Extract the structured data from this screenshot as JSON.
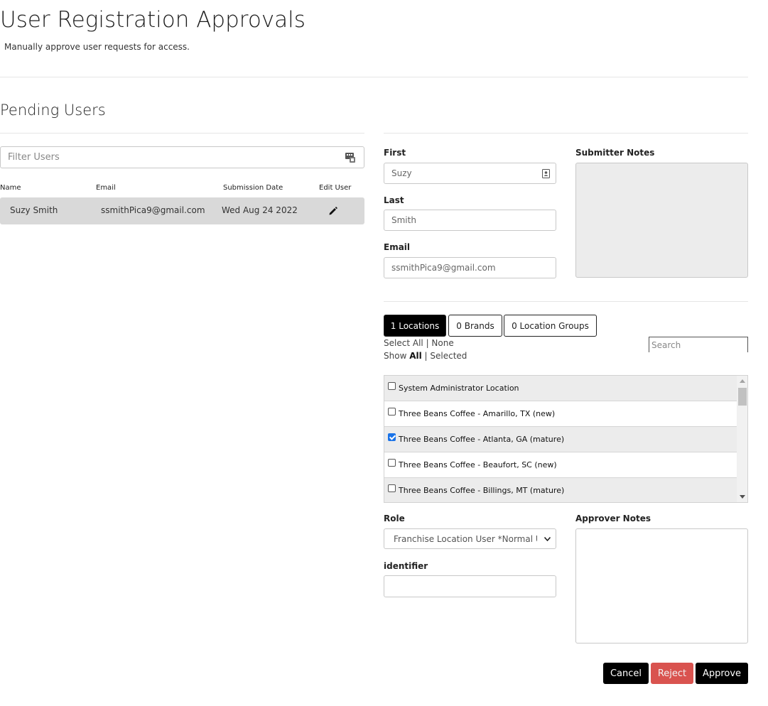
{
  "header": {
    "title": "User Registration Approvals",
    "subtitle": "Manually approve user requests for access."
  },
  "pending": {
    "title": "Pending Users",
    "filter_placeholder": "Filter Users",
    "columns": [
      "Name",
      "Email",
      "Submission Date",
      "Edit User"
    ],
    "rows": [
      {
        "name": "Suzy Smith",
        "email": "ssmithPica9@gmail.com",
        "date": "Wed Aug 24 2022"
      }
    ]
  },
  "form": {
    "first_label": "First",
    "first_value": "Suzy",
    "last_label": "Last",
    "last_value": "Smith",
    "email_label": "Email",
    "email_value": "ssmithPica9@gmail.com",
    "submitter_notes_label": "Submitter Notes"
  },
  "tabs": [
    {
      "label": "1 Locations",
      "active": true
    },
    {
      "label": "0 Brands",
      "active": false
    },
    {
      "label": "0 Location Groups",
      "active": false
    }
  ],
  "selection": {
    "select_label": "Select",
    "all": "All",
    "none": "None",
    "show_label": "Show",
    "selected": "Selected",
    "search_placeholder": "Search"
  },
  "locations": [
    {
      "name": "System Administrator Location",
      "checked": false
    },
    {
      "name": "Three Beans Coffee - Amarillo, TX (new)",
      "checked": false
    },
    {
      "name": "Three Beans Coffee - Atlanta, GA (mature)",
      "checked": true
    },
    {
      "name": "Three Beans Coffee - Beaufort, SC (new)",
      "checked": false
    },
    {
      "name": "Three Beans Coffee - Billings, MT (mature)",
      "checked": false
    }
  ],
  "role": {
    "label": "Role",
    "value": "Franchise Location User *Normal User*"
  },
  "identifier": {
    "label": "identifier",
    "value": ""
  },
  "approver_notes_label": "Approver Notes",
  "buttons": {
    "cancel": "Cancel",
    "reject": "Reject",
    "approve": "Approve"
  },
  "colors": {
    "reject": "#d9534f",
    "dark": "#000000",
    "checkbox_checked": "#1a73e8",
    "row_highlight": "#d9d9d9"
  }
}
